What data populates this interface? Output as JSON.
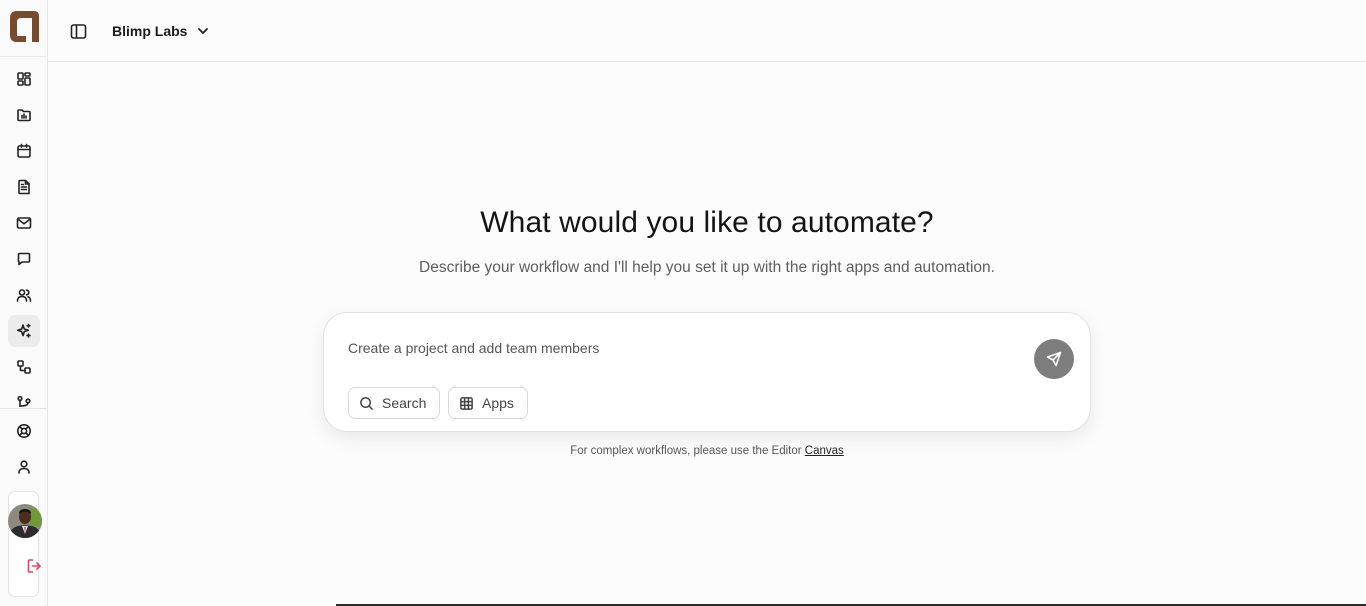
{
  "header": {
    "workspace_name": "Blimp Labs"
  },
  "sidebar": {
    "items": [
      {
        "icon": "dashboard-icon"
      },
      {
        "icon": "folder-chart-icon"
      },
      {
        "icon": "calendar-icon"
      },
      {
        "icon": "document-icon"
      },
      {
        "icon": "mail-icon"
      },
      {
        "icon": "chat-icon"
      },
      {
        "icon": "users-icon"
      },
      {
        "icon": "sparkles-icon",
        "active": true
      },
      {
        "icon": "workflow-icon"
      },
      {
        "icon": "git-branch-icon"
      },
      {
        "icon": "help-lifebuoy-icon"
      },
      {
        "icon": "user-icon"
      }
    ],
    "logout_icon": "logout-icon"
  },
  "main": {
    "title": "What would you like to automate?",
    "subtitle": "Describe your workflow and I'll help you set it up with the right apps and automation.",
    "prompt": {
      "placeholder": "Create a project and add team members",
      "value": ""
    },
    "chips": {
      "search_label": "Search",
      "apps_label": "Apps"
    },
    "footnote_text": "For complex workflows, please use the Editor ",
    "footnote_link": "Canvas"
  },
  "colors": {
    "brand": "#7a4a2e",
    "send_button": "#7d7d7d",
    "logout": "#e0455a",
    "active_nav_bg": "#ececec"
  }
}
